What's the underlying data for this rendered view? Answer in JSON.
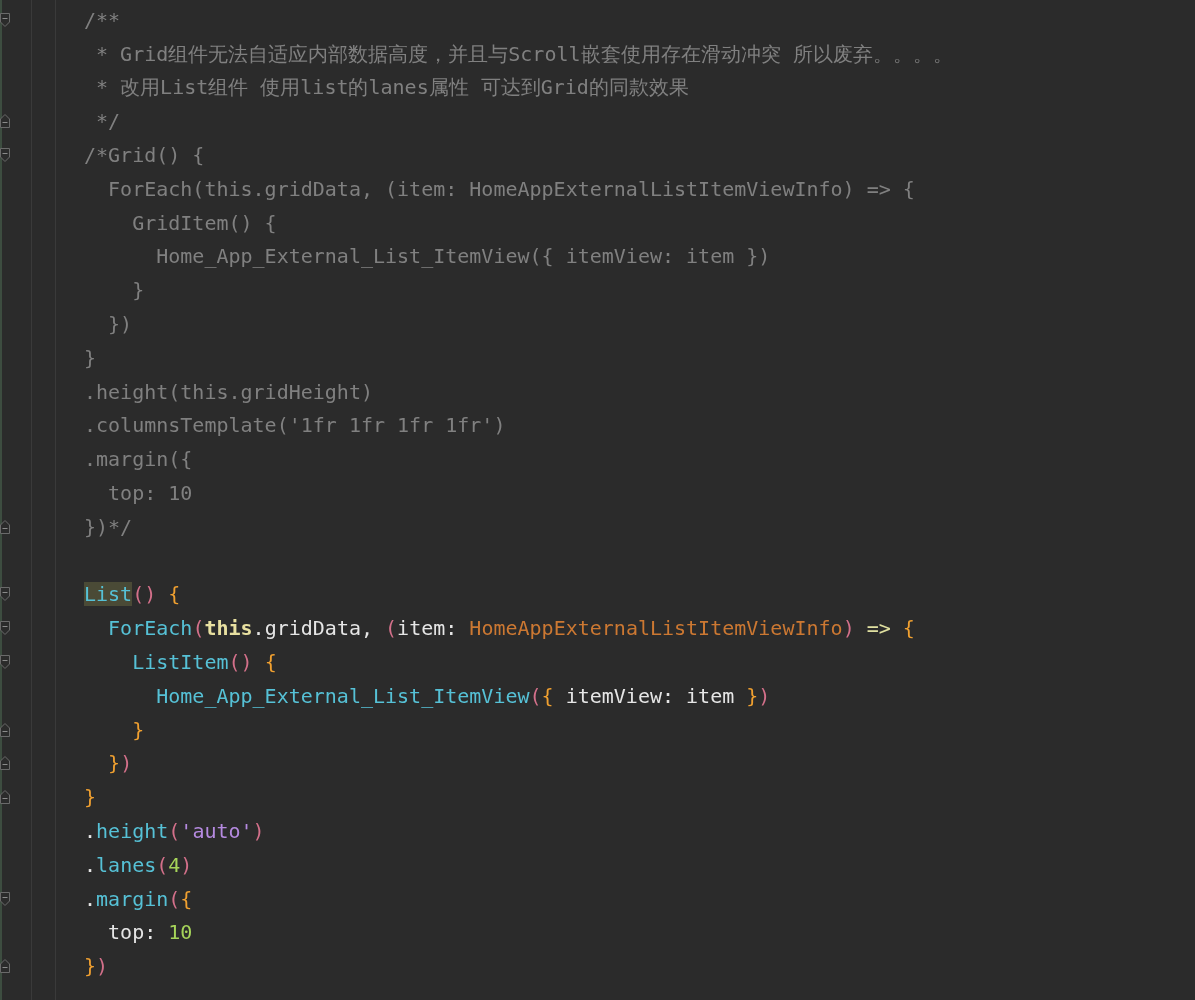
{
  "editor": {
    "lines": [
      {
        "fold_start": true,
        "tokens": [
          {
            "text": "/**",
            "kind": "comment"
          }
        ]
      },
      {
        "tokens": [
          {
            "text": " * Grid组件无法自适应内部数据高度，并且与Scroll嵌套使用存在滑动冲突 所以废弃。。。。",
            "kind": "comment"
          }
        ]
      },
      {
        "tokens": [
          {
            "text": " * 改用List组件 使用list的lanes属性 可达到Grid的同款效果",
            "kind": "comment"
          }
        ]
      },
      {
        "fold_end": true,
        "tokens": [
          {
            "text": " */",
            "kind": "comment"
          }
        ]
      },
      {
        "fold_start": true,
        "tokens": [
          {
            "text": "/*Grid() {",
            "kind": "comment"
          }
        ]
      },
      {
        "tokens": [
          {
            "text": "  ForEach(this.gridData, (item: HomeAppExternalListItemViewInfo) => {",
            "kind": "comment"
          }
        ]
      },
      {
        "tokens": [
          {
            "text": "    GridItem() {",
            "kind": "comment"
          }
        ]
      },
      {
        "tokens": [
          {
            "text": "      Home_App_External_List_ItemView({ itemView: item })",
            "kind": "comment"
          }
        ]
      },
      {
        "tokens": [
          {
            "text": "    }",
            "kind": "comment"
          }
        ]
      },
      {
        "tokens": [
          {
            "text": "  })",
            "kind": "comment"
          }
        ]
      },
      {
        "tokens": [
          {
            "text": "}",
            "kind": "comment"
          }
        ]
      },
      {
        "tokens": [
          {
            "text": ".height(this.gridHeight)",
            "kind": "comment"
          }
        ]
      },
      {
        "tokens": [
          {
            "text": ".columnsTemplate('1fr 1fr 1fr 1fr')",
            "kind": "comment"
          }
        ]
      },
      {
        "tokens": [
          {
            "text": ".margin({",
            "kind": "comment"
          }
        ]
      },
      {
        "tokens": [
          {
            "text": "  top: 10",
            "kind": "comment"
          }
        ]
      },
      {
        "fold_end": true,
        "tokens": [
          {
            "text": "})*/",
            "kind": "comment"
          }
        ]
      },
      {
        "fold_start": true,
        "blank_before": true,
        "tokens": [
          {
            "text": "List",
            "kind": "match"
          },
          {
            "text": "() ",
            "kind": "paren"
          },
          {
            "text": "{",
            "kind": "brace"
          }
        ]
      },
      {
        "fold_start": true,
        "tokens": [
          {
            "text": "  ForEach",
            "kind": "fn"
          },
          {
            "text": "(",
            "kind": "paren"
          },
          {
            "text": "this",
            "kind": "keyword"
          },
          {
            "text": ".gridData, ",
            "kind": "plain"
          },
          {
            "text": "(",
            "kind": "paren"
          },
          {
            "text": "item: ",
            "kind": "plain"
          },
          {
            "text": "HomeAppExternalListItemViewInfo",
            "kind": "type"
          },
          {
            "text": ") ",
            "kind": "paren"
          },
          {
            "text": "=> ",
            "kind": "operator"
          },
          {
            "text": "{",
            "kind": "brace"
          }
        ]
      },
      {
        "fold_start": true,
        "tokens": [
          {
            "text": "    ListItem",
            "kind": "fn"
          },
          {
            "text": "() ",
            "kind": "paren"
          },
          {
            "text": "{",
            "kind": "brace"
          }
        ]
      },
      {
        "tokens": [
          {
            "text": "      Home_App_External_List_ItemView",
            "kind": "fn"
          },
          {
            "text": "(",
            "kind": "paren"
          },
          {
            "text": "{",
            "kind": "brace"
          },
          {
            "text": " itemView: item ",
            "kind": "plain"
          },
          {
            "text": "}",
            "kind": "brace"
          },
          {
            "text": ")",
            "kind": "paren"
          }
        ]
      },
      {
        "fold_end": true,
        "tokens": [
          {
            "text": "    }",
            "kind": "brace"
          }
        ]
      },
      {
        "fold_end": true,
        "tokens": [
          {
            "text": "  }",
            "kind": "brace"
          },
          {
            "text": ")",
            "kind": "paren"
          }
        ]
      },
      {
        "fold_end": true,
        "tokens": [
          {
            "text": "}",
            "kind": "brace"
          }
        ]
      },
      {
        "tokens": [
          {
            "text": ".",
            "kind": "plain"
          },
          {
            "text": "height",
            "kind": "fn"
          },
          {
            "text": "(",
            "kind": "paren"
          },
          {
            "text": "'auto'",
            "kind": "string"
          },
          {
            "text": ")",
            "kind": "paren"
          }
        ]
      },
      {
        "tokens": [
          {
            "text": ".",
            "kind": "plain"
          },
          {
            "text": "lanes",
            "kind": "fn"
          },
          {
            "text": "(",
            "kind": "paren"
          },
          {
            "text": "4",
            "kind": "number"
          },
          {
            "text": ")",
            "kind": "paren"
          }
        ]
      },
      {
        "fold_start": true,
        "tokens": [
          {
            "text": ".",
            "kind": "plain"
          },
          {
            "text": "margin",
            "kind": "fn"
          },
          {
            "text": "(",
            "kind": "paren"
          },
          {
            "text": "{",
            "kind": "brace"
          }
        ]
      },
      {
        "tokens": [
          {
            "text": "  top: ",
            "kind": "plain"
          },
          {
            "text": "10",
            "kind": "number"
          }
        ]
      },
      {
        "fold_end": true,
        "tokens": [
          {
            "text": "}",
            "kind": "brace"
          },
          {
            "text": ")",
            "kind": "paren"
          }
        ]
      }
    ]
  }
}
